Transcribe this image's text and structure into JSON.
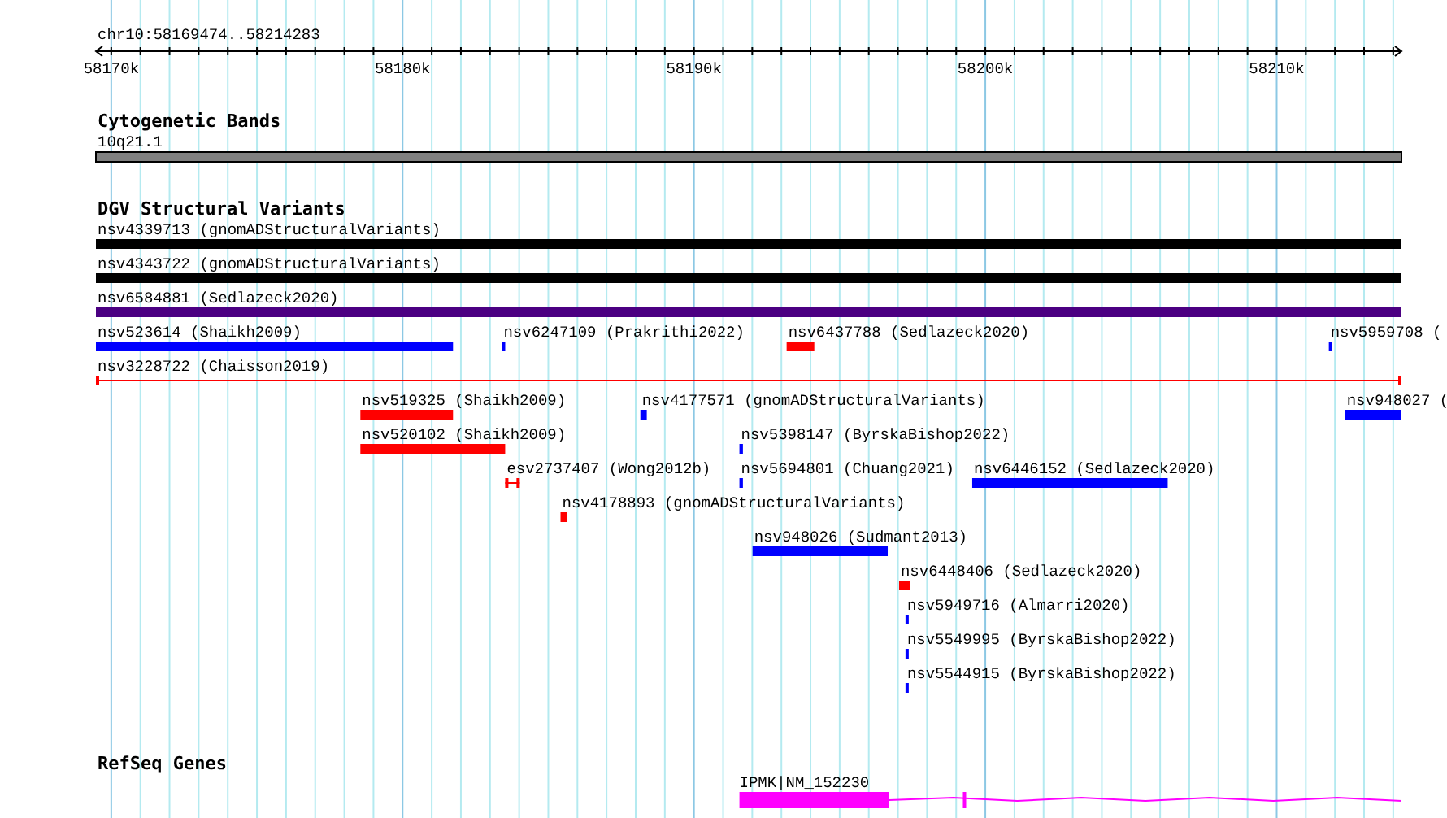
{
  "position": "chr10:58169474..58214283",
  "ruler": {
    "ticks": [
      {
        "label": "58170k"
      },
      {
        "label": "58180k"
      },
      {
        "label": "58190k"
      },
      {
        "label": "58200k"
      },
      {
        "label": "58210k"
      }
    ]
  },
  "tracks": [
    {
      "kind": "bands",
      "title": "Cytogenetic Bands",
      "bands": [
        {
          "label": "10q21.1",
          "color": "#808080"
        }
      ]
    },
    {
      "kind": "variants",
      "title": "DGV Structural Variants",
      "lanes": [
        {
          "features": [
            {
              "kind": "bar",
              "label": "nsv4339713 (gnomADStructuralVariants)",
              "color": "#000000"
            }
          ]
        },
        {
          "features": [
            {
              "kind": "bar",
              "label": "nsv4343722 (gnomADStructuralVariants)",
              "color": "#000000"
            }
          ]
        },
        {
          "features": [
            {
              "kind": "bar",
              "label": "nsv6584881 (Sedlazeck2020)",
              "color": "#4b0082"
            }
          ]
        },
        {
          "features": [
            {
              "kind": "bar",
              "label": "nsv523614 (Shaikh2009)",
              "color": "#0000ff"
            },
            {
              "kind": "bar",
              "label": "nsv6247109 (Prakrithi2022)",
              "color": "#0000ff"
            },
            {
              "kind": "bar",
              "label": "nsv6437788 (Sedlazeck2020)",
              "color": "#ff0000"
            },
            {
              "kind": "bar",
              "label": "nsv5959708 (",
              "color": "#0000ff"
            }
          ]
        },
        {
          "features": [
            {
              "kind": "range",
              "label": "nsv3228722 (Chaisson2019)",
              "color": "#ff0000"
            }
          ]
        },
        {
          "features": [
            {
              "kind": "bar",
              "label": "nsv519325 (Shaikh2009)",
              "color": "#ff0000"
            },
            {
              "kind": "bar",
              "label": "nsv4177571 (gnomADStructuralVariants)",
              "color": "#0000ff"
            },
            {
              "kind": "bar",
              "label": "nsv948027 (",
              "color": "#0000ff"
            }
          ]
        },
        {
          "features": [
            {
              "kind": "bar",
              "label": "nsv520102 (Shaikh2009)",
              "color": "#ff0000"
            },
            {
              "kind": "bar",
              "label": "nsv5398147 (ByrskaBishop2022)",
              "color": "#0000ff"
            }
          ]
        },
        {
          "features": [
            {
              "kind": "range",
              "label": "esv2737407 (Wong2012b)",
              "color": "#ff0000"
            },
            {
              "kind": "bar",
              "label": "nsv5694801 (Chuang2021)",
              "color": "#0000ff"
            },
            {
              "kind": "bar",
              "label": "nsv6446152 (Sedlazeck2020)",
              "color": "#0000ff"
            }
          ]
        },
        {
          "features": [
            {
              "kind": "bar",
              "label": "nsv4178893 (gnomADStructuralVariants)",
              "color": "#ff0000"
            }
          ]
        },
        {
          "features": [
            {
              "kind": "bar",
              "label": "nsv948026 (Sudmant2013)",
              "color": "#0000ff"
            }
          ]
        },
        {
          "features": [
            {
              "kind": "bar",
              "label": "nsv6448406 (Sedlazeck2020)",
              "color": "#ff0000"
            }
          ]
        },
        {
          "features": [
            {
              "kind": "bar",
              "label": "nsv5949716 (Almarri2020)",
              "color": "#0000ff"
            }
          ]
        },
        {
          "features": [
            {
              "kind": "bar",
              "label": "nsv5549995 (ByrskaBishop2022)",
              "color": "#0000ff"
            }
          ]
        },
        {
          "features": [
            {
              "kind": "bar",
              "label": "nsv5544915 (ByrskaBishop2022)",
              "color": "#0000ff"
            }
          ]
        }
      ]
    },
    {
      "kind": "genes",
      "title": "RefSeq Genes",
      "genes": [
        {
          "label": "IPMK|NM_152230",
          "color": "#ff00ff"
        }
      ]
    }
  ]
}
